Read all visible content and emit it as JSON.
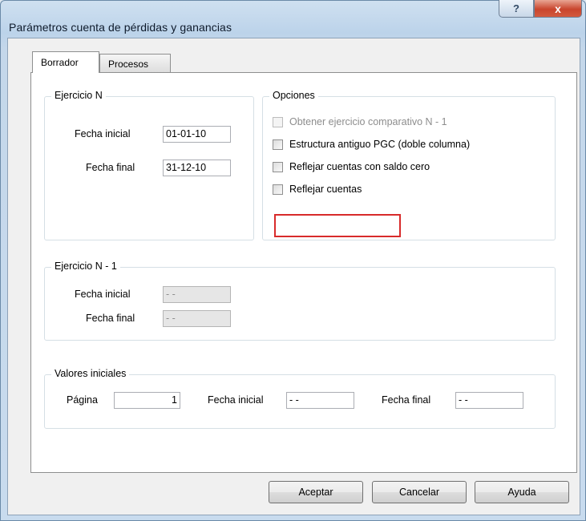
{
  "window": {
    "title": "Parámetros cuenta de pérdidas y ganancias",
    "help_label": "?",
    "close_label": "x"
  },
  "tabs": [
    {
      "label": "Borrador",
      "active": true
    },
    {
      "label": "Procesos",
      "active": false
    }
  ],
  "ejercicio_n": {
    "legend": "Ejercicio N",
    "fecha_inicial_label": "Fecha inicial",
    "fecha_inicial_value": "01-01-10",
    "fecha_final_label": "Fecha final",
    "fecha_final_value": "31-12-10"
  },
  "opciones": {
    "legend": "Opciones",
    "items": [
      {
        "label": "Obtener ejercicio comparativo N - 1",
        "checked": false,
        "enabled": false
      },
      {
        "label": "Estructura antiguo PGC (doble columna)",
        "checked": false,
        "enabled": true
      },
      {
        "label": "Reflejar cuentas con saldo cero",
        "checked": false,
        "enabled": true
      },
      {
        "label": "Reflejar cuentas",
        "checked": false,
        "enabled": true,
        "highlighted": true
      }
    ],
    "highlight_color": "#d82b2b"
  },
  "ejercicio_n1": {
    "legend": "Ejercicio N - 1",
    "fecha_inicial_label": "Fecha inicial",
    "fecha_inicial_value": "- -",
    "fecha_final_label": "Fecha final",
    "fecha_final_value": "- -"
  },
  "valores_iniciales": {
    "legend": "Valores iniciales",
    "pagina_label": "Página",
    "pagina_value": "1",
    "fecha_inicial_label": "Fecha inicial",
    "fecha_inicial_value": "- -",
    "fecha_final_label": "Fecha final",
    "fecha_final_value": "- -"
  },
  "buttons": {
    "aceptar": "Aceptar",
    "cancelar": "Cancelar",
    "ayuda": "Ayuda"
  }
}
